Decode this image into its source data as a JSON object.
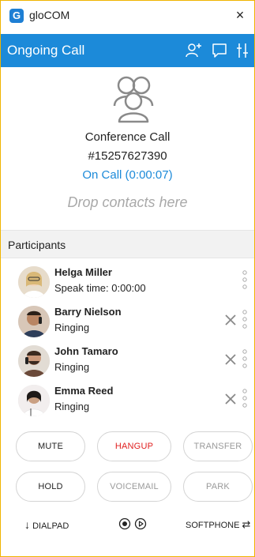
{
  "window": {
    "app_title": "gloCOM",
    "close_glyph": "×",
    "logo_letter": "G"
  },
  "header": {
    "title": "Ongoing Call"
  },
  "conference": {
    "title": "Conference Call",
    "number": "#15257627390",
    "status": "On Call (0:00:07)",
    "drop_placeholder": "Drop contacts here"
  },
  "participants": {
    "label": "Participants",
    "items": [
      {
        "name": "Helga Miller",
        "status": "Speak time: 0:00:00",
        "removable": false
      },
      {
        "name": "Barry Nielson",
        "status": "Ringing",
        "removable": true
      },
      {
        "name": "John Tamaro",
        "status": "Ringing",
        "removable": true
      },
      {
        "name": "Emma Reed",
        "status": "Ringing",
        "removable": true
      }
    ]
  },
  "actions": {
    "mute": "MUTE",
    "hangup": "HANGUP",
    "transfer": "TRANSFER",
    "hold": "HOLD",
    "voicemail": "VOICEMAIL",
    "park": "PARK"
  },
  "bottom": {
    "dialpad": "DIALPAD",
    "softphone": "SOFTPHONE"
  },
  "colors": {
    "accent": "#1c8ad9",
    "danger": "#e02020",
    "window_border": "#f0b400"
  }
}
